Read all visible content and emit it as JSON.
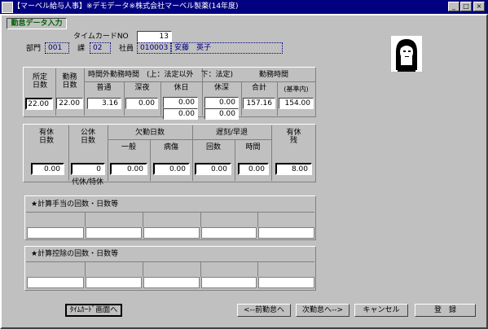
{
  "window": {
    "title": "【マーベル給与人事】※デモデータ※株式会社マーベル製薬(14年度)",
    "min_label": "_",
    "max_label": "□",
    "close_label": "×"
  },
  "header": {
    "badge": "勤怠データ入力",
    "timecard_label": "タイムカードNO",
    "timecard_value": "13",
    "dept_label": "部門",
    "dept_value": "001",
    "section_label": "課",
    "section_value": "02",
    "emp_label": "社員",
    "emp_code": "010003",
    "emp_name": "安藤　英子"
  },
  "attendance": {
    "h_scheduled": "所定\n日数",
    "h_worked": "勤務\n日数",
    "h_overtime": "時間外勤務時間　(上：法定以外　下：法定)",
    "h_hours_group": "勤務時間",
    "h_normal": "普通",
    "h_late": "深夜",
    "h_holiday": "休日",
    "h_holiday_late": "休深",
    "h_total": "合計",
    "h_standard": "(基準内)",
    "v_scheduled": "22.00",
    "v_worked": "22.00",
    "v_normal": "3.16",
    "v_late": "0.00",
    "v_holiday_top": "0.00",
    "v_holiday_bottom": "0.00",
    "v_holiday_late_top": "0.00",
    "v_holiday_late_bottom": "0.00",
    "v_total": "157.16",
    "v_standard": "154.00"
  },
  "leave": {
    "h_paid": "有休\n日数",
    "h_public": "公休\n日数",
    "h_absence": "欠勤日数",
    "h_general": "一般",
    "h_sick": "病傷",
    "h_late_early": "遅刻/早退",
    "h_count": "回数",
    "h_time": "時間",
    "h_paid_remaining": "有休\n残",
    "v_paid": "0.00",
    "v_public": "0",
    "v_general": "0.00",
    "v_sick": "0.00",
    "v_count": "0.00",
    "v_time": "0.00",
    "v_paid_remaining": "8.00",
    "substitute_label": "代休/特休"
  },
  "allowance": {
    "title": "★計算手当の回数・日数等"
  },
  "deduction": {
    "title": "★計算控除の回数・日数等"
  },
  "buttons": {
    "timecard_screen": "ﾀｲﾑｶｰﾄﾞ画面へ",
    "prev": "<--前勤怠へ",
    "next": "次勤怠へ-->",
    "cancel": "キャンセル",
    "register": "登　録"
  },
  "colors": {
    "titlebar": "#000080",
    "face": "#c0c0c0",
    "badge_text": "#006400",
    "dotted_text": "#000080"
  }
}
